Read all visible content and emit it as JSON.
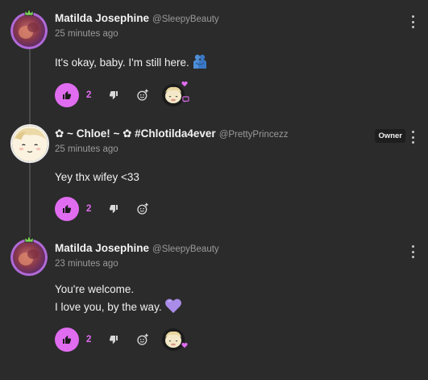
{
  "comments": [
    {
      "display_name": "Matilda Josephine",
      "handle": "@SleepyBeauty",
      "timestamp": "25 minutes ago",
      "body_lines": [
        "It's okay, baby. I'm still here."
      ],
      "body_emoji": "people-hugging",
      "likes": "2",
      "badge": "",
      "has_reaction": true
    },
    {
      "display_name": "✿ ~ Chloe! ~ ✿ #Chlotilda4ever",
      "handle": "@PrettyPrincezz",
      "timestamp": "25 minutes ago",
      "body_lines": [
        "Yey thx wifey <33"
      ],
      "body_emoji": "",
      "likes": "2",
      "badge": "Owner",
      "has_reaction": false
    },
    {
      "display_name": "Matilda Josephine",
      "handle": "@SleepyBeauty",
      "timestamp": "23 minutes ago",
      "body_lines": [
        "You're welcome.",
        "I love you, by the way."
      ],
      "body_emoji": "purple-heart",
      "likes": "2",
      "badge": "",
      "has_reaction": true
    }
  ],
  "colors": {
    "background": "#2b2b2b",
    "accent": "#e06cf0",
    "muted_text": "#9a9a9a",
    "purple_heart": "#a98be8",
    "thread_line": "#4a4a4a"
  },
  "icons": {
    "like": "thumbs-up-icon",
    "dislike": "thumbs-down-icon",
    "react": "add-reaction-icon",
    "more": "more-vertical-icon"
  }
}
